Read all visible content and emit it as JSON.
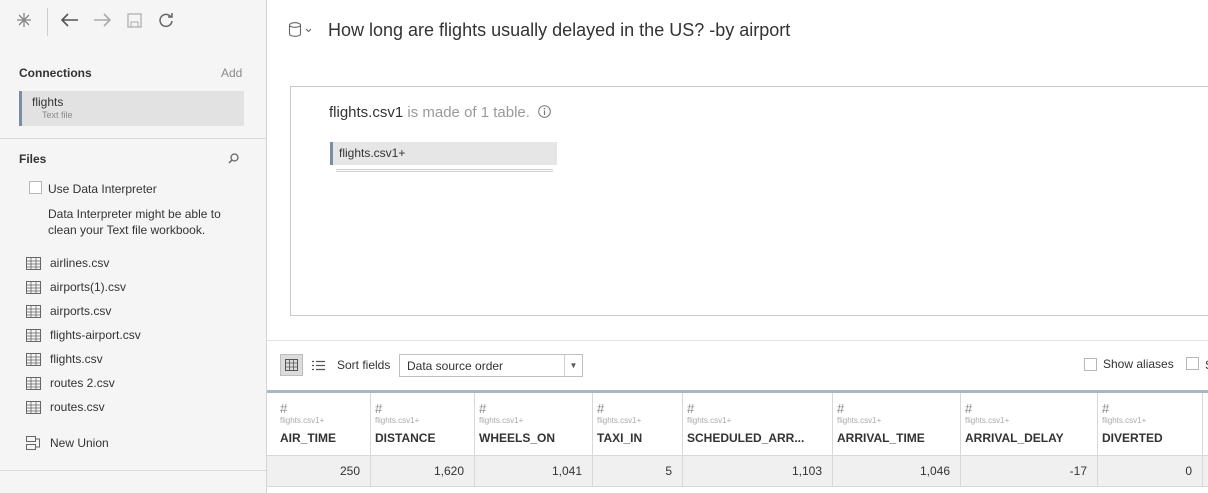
{
  "toolbar": {
    "icons": [
      "tableau-logo-icon",
      "back-arrow-icon",
      "forward-arrow-icon",
      "save-icon",
      "refresh-icon"
    ]
  },
  "sidebar": {
    "connections_title": "Connections",
    "add_label": "Add",
    "connection": {
      "name": "flights",
      "type": "Text file"
    },
    "files_title": "Files",
    "use_data_interpreter": "Use Data Interpreter",
    "data_interpreter_help": "Data Interpreter might be able to clean your Text file workbook.",
    "files": [
      "airlines.csv",
      "airports(1).csv",
      "airports.csv",
      "flights-airport.csv",
      "flights.csv",
      "routes 2.csv",
      "routes.csv"
    ],
    "new_union": "New Union"
  },
  "main": {
    "datasource_title": "How long are flights usually delayed in the US? -by airport",
    "canvas": {
      "table_name": "flights.csv1",
      "made_of_text": "is made of 1 table.",
      "table_pill": "flights.csv1+"
    },
    "grid_toolbar": {
      "sort_label": "Sort fields",
      "sort_value": "Data source order",
      "show_aliases": "Show aliases",
      "second_checkbox_label": "S"
    },
    "columns": [
      {
        "source": "flights.csv1+",
        "name": "AIR_TIME",
        "value": "250"
      },
      {
        "source": "flights.csv1+",
        "name": "DISTANCE",
        "value": "1,620"
      },
      {
        "source": "flights.csv1+",
        "name": "WHEELS_ON",
        "value": "1,041"
      },
      {
        "source": "flights.csv1+",
        "name": "TAXI_IN",
        "value": "5"
      },
      {
        "source": "flights.csv1+",
        "name": "SCHEDULED_ARR...",
        "value": "1,103"
      },
      {
        "source": "flights.csv1+",
        "name": "ARRIVAL_TIME",
        "value": "1,046"
      },
      {
        "source": "flights.csv1+",
        "name": "ARRIVAL_DELAY",
        "value": "-17"
      },
      {
        "source": "flights.csv1+",
        "name": "DIVERTED",
        "value": "0"
      }
    ]
  }
}
